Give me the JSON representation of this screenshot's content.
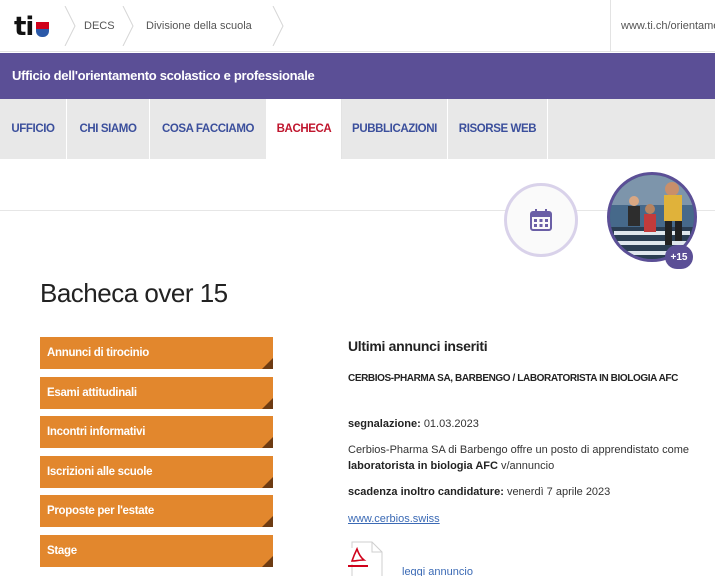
{
  "header": {
    "logo_text": "ti",
    "breadcrumb": [
      "DECS",
      "Divisione della scuola"
    ],
    "site_url": "www.ti.ch/orientamento"
  },
  "band": {
    "title": "Ufficio dell'orientamento scolastico e professionale"
  },
  "tabs": [
    {
      "label": "UFFICIO"
    },
    {
      "label": "CHI SIAMO"
    },
    {
      "label": "COSA FACCIAMO"
    },
    {
      "label": "BACHECA",
      "active": true
    },
    {
      "label": "PUBBLICAZIONI"
    },
    {
      "label": "RISORSE WEB"
    }
  ],
  "badge": "+15",
  "page_title": "Bacheca over 15",
  "menu": [
    {
      "label": "Annunci di tirocinio"
    },
    {
      "label": "Esami attitudinali"
    },
    {
      "label": "Incontri informativi"
    },
    {
      "label": "Iscrizioni alle scuole"
    },
    {
      "label": "Proposte per l'estate"
    },
    {
      "label": "Stage"
    }
  ],
  "content": {
    "section_title": "Ultimi annunci inseriti",
    "ad_heading": "CERBIOS-PHARMA SA, BARBENGO / LABORATORISTA IN BIOLOGIA AFC",
    "segnalazione_label": "segnalazione:",
    "segnalazione_value": "01.03.2023",
    "desc_line1": "Cerbios-Pharma SA di Barbengo offre un posto di apprendistato come",
    "desc_bold": "laboratorista in biologia AFC",
    "desc_rest": "v/annuncio",
    "scadenza_label": "scadenza inoltro candidature:",
    "scadenza_value": "venerdì 7 aprile 2023",
    "website": "www.cerbios.swiss",
    "pdf_link": "leggi annuncio"
  },
  "colors": {
    "purple": "#5b4f96",
    "orange": "#e2872d",
    "active_tab_red": "#c0162e",
    "tab_text_blue": "#3b4f9c",
    "link_blue": "#3b6ab5"
  },
  "icons": [
    "canton-ticino-shield-icon",
    "calendar-icon",
    "pdf-file-icon"
  ]
}
